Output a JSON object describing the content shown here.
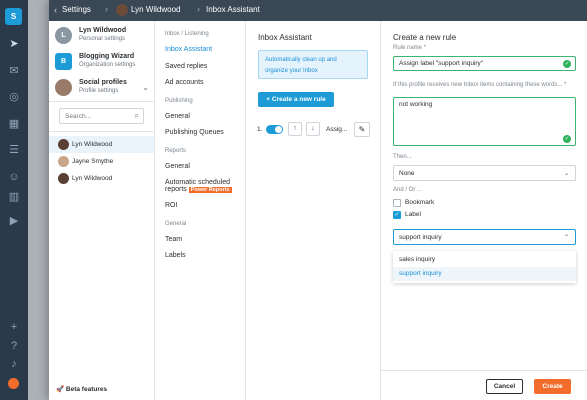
{
  "app": {
    "logo_letter": "S"
  },
  "topbar": {
    "crumbs": [
      "Settings",
      "Lyn Wildwood",
      "Inbox Assistant"
    ]
  },
  "profiles": {
    "items": [
      {
        "name": "Lyn Wildwood",
        "sub": "Personal settings",
        "initial": "L",
        "color": "#8a96a1"
      },
      {
        "name": "Blogging Wizard",
        "sub": "Organization settings",
        "initial": "B",
        "color": "#1d9bd7"
      },
      {
        "name": "Social profiles",
        "sub": "Profile settings"
      }
    ],
    "search_placeholder": "Search...",
    "list": [
      "Lyn Wildwood",
      "Jayne Smythe",
      "Lyn Wildwood"
    ],
    "beta": "Beta features"
  },
  "nav": {
    "sections": [
      {
        "heading": "Inbox / Listening",
        "items": [
          "Inbox Assistant",
          "Saved replies",
          "Ad accounts"
        ]
      },
      {
        "heading": "Publishing",
        "items": [
          "General",
          "Publishing Queues"
        ]
      },
      {
        "heading": "Reports",
        "items": [
          "General",
          "Automatic scheduled",
          "ROI"
        ]
      },
      {
        "heading": "General",
        "items": [
          "Team",
          "Labels"
        ]
      }
    ],
    "reports_line2": "reports",
    "power_badge": "Power Reports"
  },
  "assistant": {
    "title": "Inbox Assistant",
    "info_line1": "Automatically clean up and",
    "info_line2": "organize your Inbox",
    "create_button": "+ Create a new rule",
    "rule": {
      "number": "1.",
      "name": "Assig...",
      "enabled": true
    }
  },
  "form": {
    "title": "Create a new rule",
    "rule_name_label": "Rule name *",
    "rule_name_value": "Assign label \"support inquiry\"",
    "words_label": "If this profile receives new Inbox items containing these words... *",
    "words_value": "not working",
    "then_label": "Then...",
    "then_value": "None",
    "andor_label": "And / Or ...",
    "bookmark_label": "Bookmark",
    "bookmark_checked": false,
    "label_label": "Label",
    "label_checked": true,
    "label_select_value": "support inquiry",
    "options": [
      "sales inquiry",
      "support inquiry"
    ],
    "cancel": "Cancel",
    "create": "Create"
  },
  "colors": {
    "accent": "#1d9bd7",
    "primary_action": "#f26c2b",
    "valid": "#2fb35b",
    "dark": "#3a4754"
  }
}
